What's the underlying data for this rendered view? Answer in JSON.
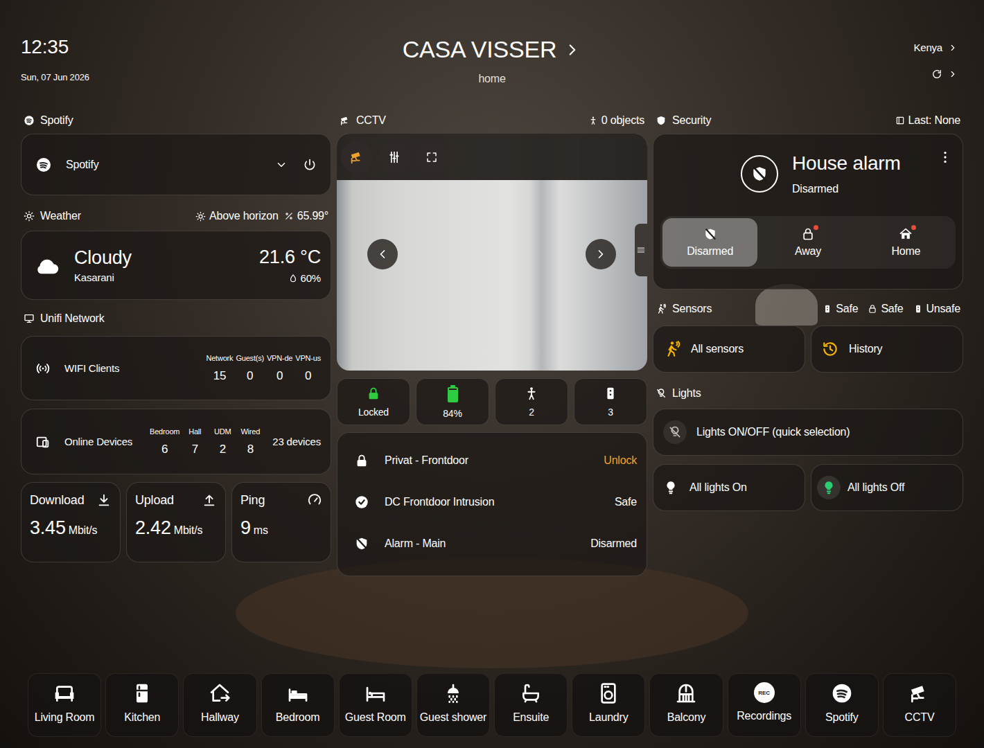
{
  "header": {
    "time": "12:35",
    "date": "Sun, 07 Jun 2026",
    "title": "CASA VISSER",
    "subtitle": "home",
    "location": "Kenya"
  },
  "spotify": {
    "section": "Spotify",
    "player": "Spotify"
  },
  "weather": {
    "section": "Weather",
    "sun": "Above horizon",
    "sun_elevation": "65.99°",
    "condition": "Cloudy",
    "location": "Kasarani",
    "temperature": "21.6 °C",
    "humidity": "60%"
  },
  "network": {
    "section": "Unifi Network",
    "wifi": {
      "label": "WIFI Clients",
      "stats": [
        {
          "label": "Network",
          "value": "15"
        },
        {
          "label": "Guest(s)",
          "value": "0"
        },
        {
          "label": "VPN-de",
          "value": "0"
        },
        {
          "label": "VPN-us",
          "value": "0"
        }
      ]
    },
    "devices": {
      "label": "Online Devices",
      "stats": [
        {
          "label": "Bedroom",
          "value": "6"
        },
        {
          "label": "Hall",
          "value": "7"
        },
        {
          "label": "UDM",
          "value": "2"
        },
        {
          "label": "Wired",
          "value": "8"
        }
      ],
      "total": "23 devices"
    },
    "speeds": [
      {
        "label": "Download",
        "value": "3.45",
        "unit": "Mbit/s"
      },
      {
        "label": "Upload",
        "value": "2.42",
        "unit": "Mbit/s"
      },
      {
        "label": "Ping",
        "value": "9",
        "unit": "ms"
      }
    ]
  },
  "cctv": {
    "section": "CCTV",
    "objects": "0 objects",
    "status": [
      {
        "kind": "lock",
        "label": "Locked",
        "locked": true,
        "color": "#2ecc40"
      },
      {
        "kind": "battery",
        "label": "84%",
        "level": 0.84,
        "color": "#2ecc40"
      },
      {
        "kind": "occupancy",
        "label": "2",
        "color": "#ffffff"
      },
      {
        "kind": "door",
        "label": "3",
        "color": "#ffffff"
      }
    ],
    "entities": [
      {
        "name": "Privat - Frontdoor",
        "state": "Unlock",
        "color": "#f0a22e"
      },
      {
        "name": "DC Frontdoor Intrusion",
        "state": "Safe",
        "color": "#ffffff"
      },
      {
        "name": "Alarm - Main",
        "state": "Disarmed",
        "color": "#ffffff"
      }
    ]
  },
  "security": {
    "section": "Security",
    "last": "Last: None",
    "alarm": {
      "title": "House alarm",
      "state": "Disarmed",
      "modes": [
        {
          "label": "Disarmed",
          "selected": true,
          "alert": false
        },
        {
          "label": "Away",
          "selected": false,
          "alert": true
        },
        {
          "label": "Home",
          "selected": false,
          "alert": true
        }
      ]
    }
  },
  "sensors": {
    "section": "Sensors",
    "states": [
      "Safe",
      "Safe",
      "Unsafe"
    ],
    "buttons": [
      "All sensors",
      "History"
    ]
  },
  "lights": {
    "section": "Lights",
    "quick": "Lights ON/OFF (quick selection)",
    "buttons": [
      {
        "label": "All lights On",
        "active": false
      },
      {
        "label": "All lights Off",
        "active": true
      }
    ]
  },
  "nav": [
    {
      "label": "Living Room"
    },
    {
      "label": "Kitchen"
    },
    {
      "label": "Hallway"
    },
    {
      "label": "Bedroom"
    },
    {
      "label": "Guest Room"
    },
    {
      "label": "Guest shower"
    },
    {
      "label": "Ensuite"
    },
    {
      "label": "Laundry"
    },
    {
      "label": "Balcony"
    },
    {
      "label": "Recordings",
      "badge": "REC"
    },
    {
      "label": "Spotify"
    },
    {
      "label": "CCTV"
    }
  ]
}
